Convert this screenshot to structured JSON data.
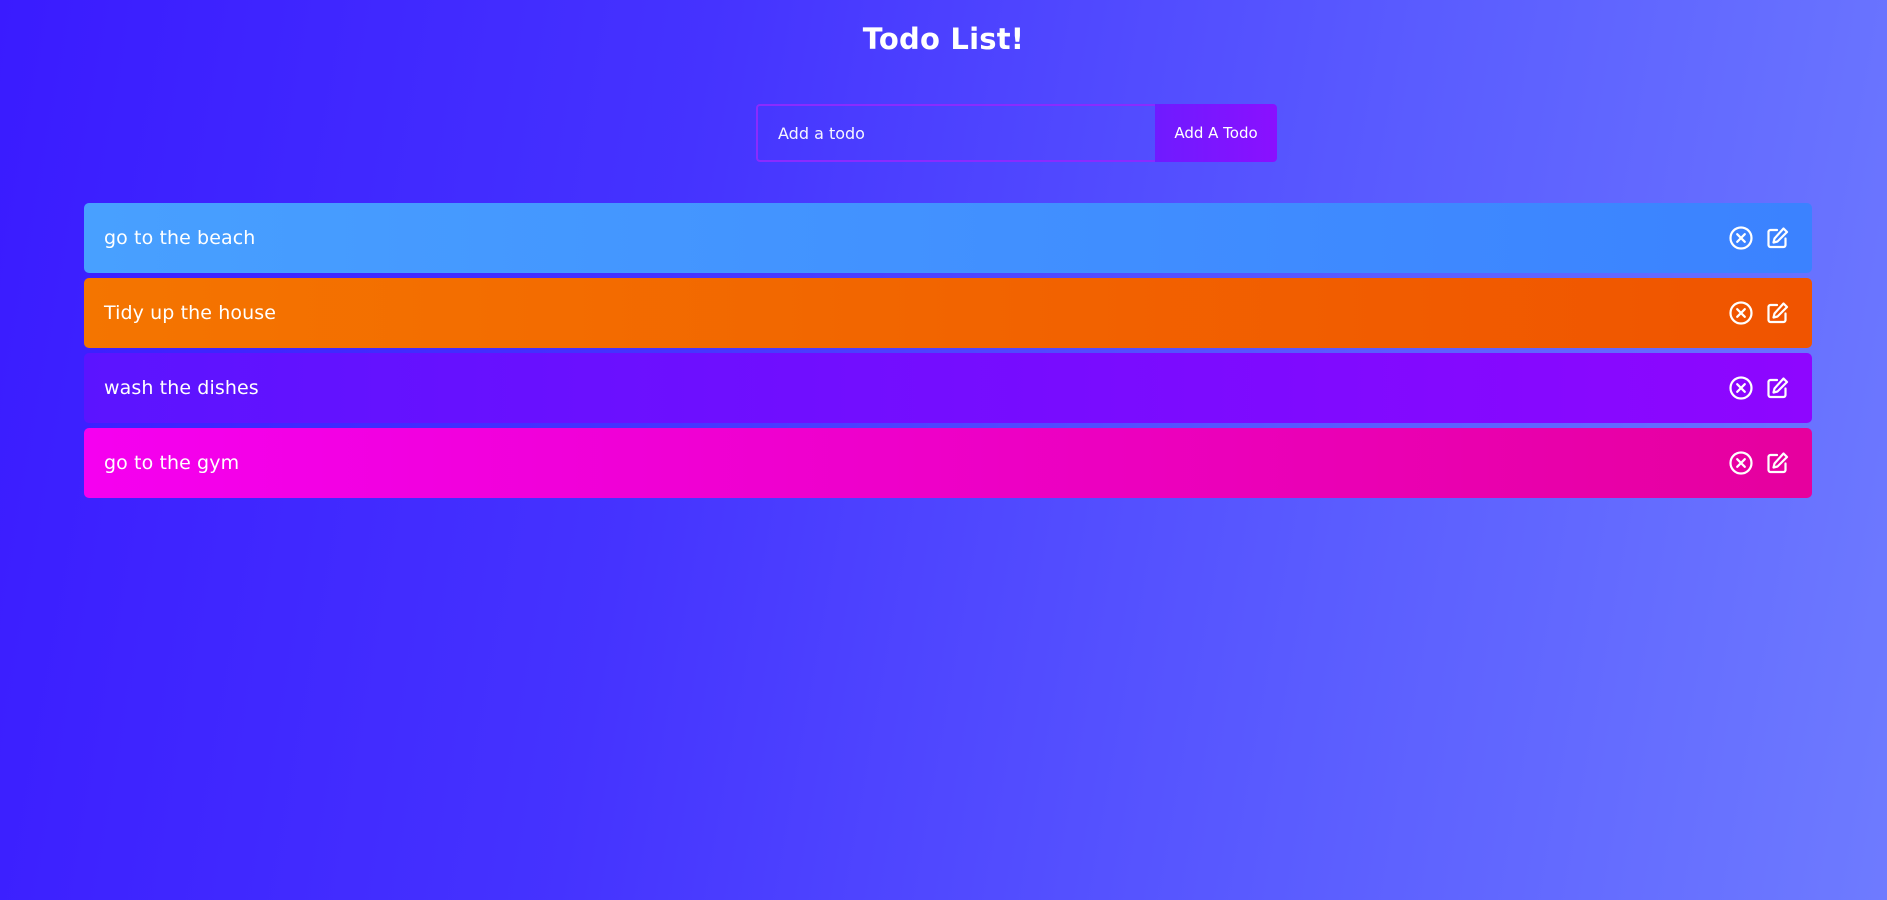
{
  "header": {
    "title": "Todo List!"
  },
  "form": {
    "placeholder": "Add a todo",
    "value": "",
    "button_label": "Add A Todo"
  },
  "todos": [
    {
      "text": "go to the beach",
      "color": "#4898ff"
    },
    {
      "text": "Tidy up the house",
      "color": "#f26400"
    },
    {
      "text": "wash the dishes",
      "color": "#740dff"
    },
    {
      "text": "go to the gym",
      "color": "#f000c8"
    }
  ],
  "icons": {
    "delete": "close-circle-icon",
    "edit": "edit-icon"
  },
  "colors": {
    "background_start": "#3a1bff",
    "background_end": "#6e7bff",
    "accent": "#8a10ff"
  }
}
